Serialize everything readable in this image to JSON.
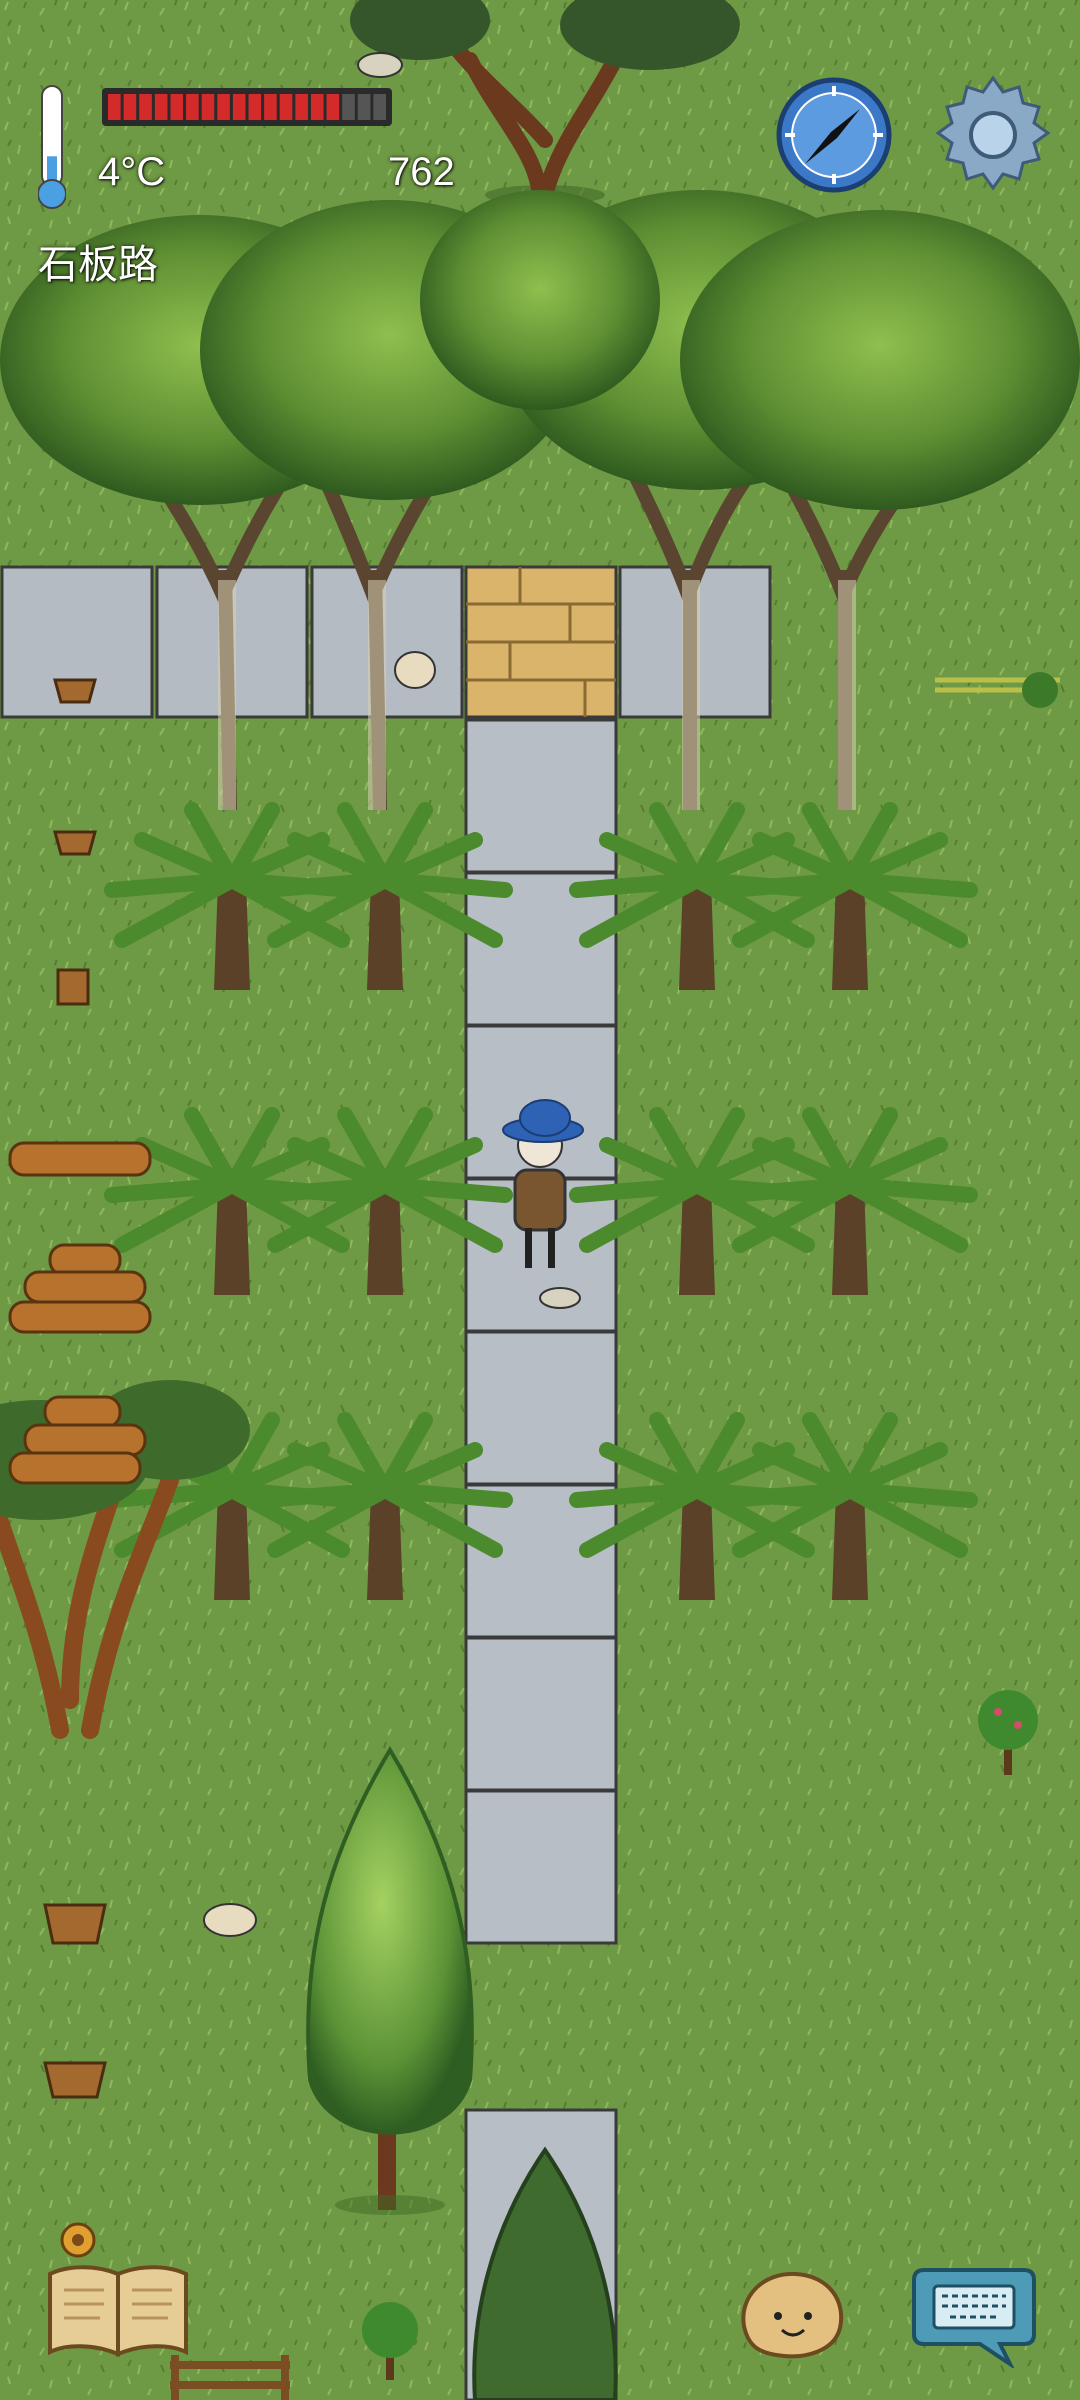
{
  "hud": {
    "temperature": "4°C",
    "score": "762",
    "location": "石板路",
    "health_segments_total": 18,
    "health_segments_filled": 15,
    "thermometer_level": 0.35,
    "compass_icon": "compass-icon",
    "settings_icon": "gear-icon"
  },
  "bottom_bar": {
    "journal_icon": "open-book-icon",
    "emote_icon": "smiling-potato-icon",
    "chat_icon": "keyboard-speech-bubble-icon",
    "small_icon": "seed-icon"
  },
  "colors": {
    "grass": "#6f9a45",
    "stone_path": "#b7bec6",
    "wood_floor": "#d9b46a",
    "health_red": "#d42a2a",
    "health_empty": "#555555",
    "compass_blue": "#3b78c8",
    "gear_blue": "#8aa9c6"
  }
}
